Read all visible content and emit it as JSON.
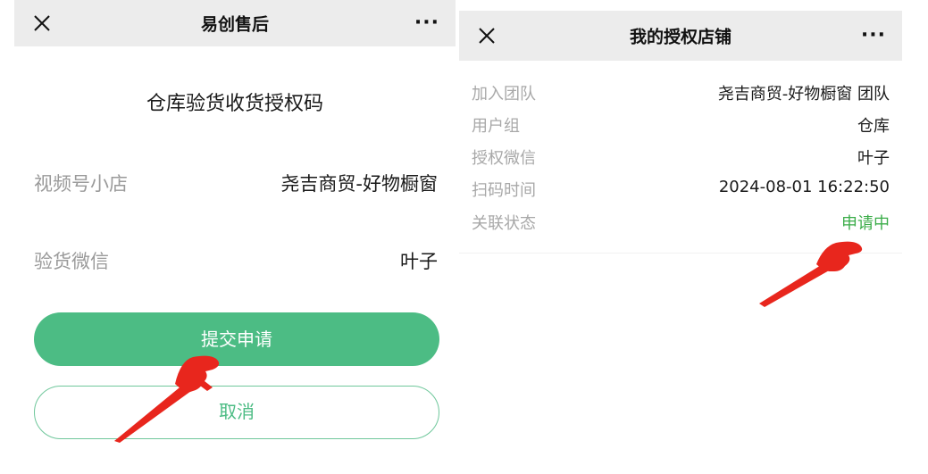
{
  "left_screen": {
    "nav": {
      "title": "易创售后",
      "more": "···"
    },
    "heading": "仓库验货收货授权码",
    "rows": [
      {
        "label": "视频号小店",
        "value": "尧吉商贸-好物橱窗"
      },
      {
        "label": "验货微信",
        "value": "叶子"
      }
    ],
    "submit_label": "提交申请",
    "cancel_label": "取消"
  },
  "right_screen": {
    "nav": {
      "title": "我的授权店铺",
      "more": "···"
    },
    "rows": [
      {
        "label": "加入团队",
        "value": "尧吉商贸-好物橱窗 团队"
      },
      {
        "label": "用户组",
        "value": "仓库"
      },
      {
        "label": "授权微信",
        "value": "叶子"
      },
      {
        "label": "扫码时间",
        "value": "2024-08-01 16:22:50"
      },
      {
        "label": "关联状态",
        "value": "申请中"
      }
    ]
  },
  "colors": {
    "primary_green": "#4cbc84",
    "status_green": "#3cad4a",
    "nav_bg": "#ececec",
    "annotation_red": "#e8261d"
  },
  "icons": {
    "close": "close-icon",
    "more": "more-icon",
    "annotation": "pointing-hand-arrow-icon"
  }
}
